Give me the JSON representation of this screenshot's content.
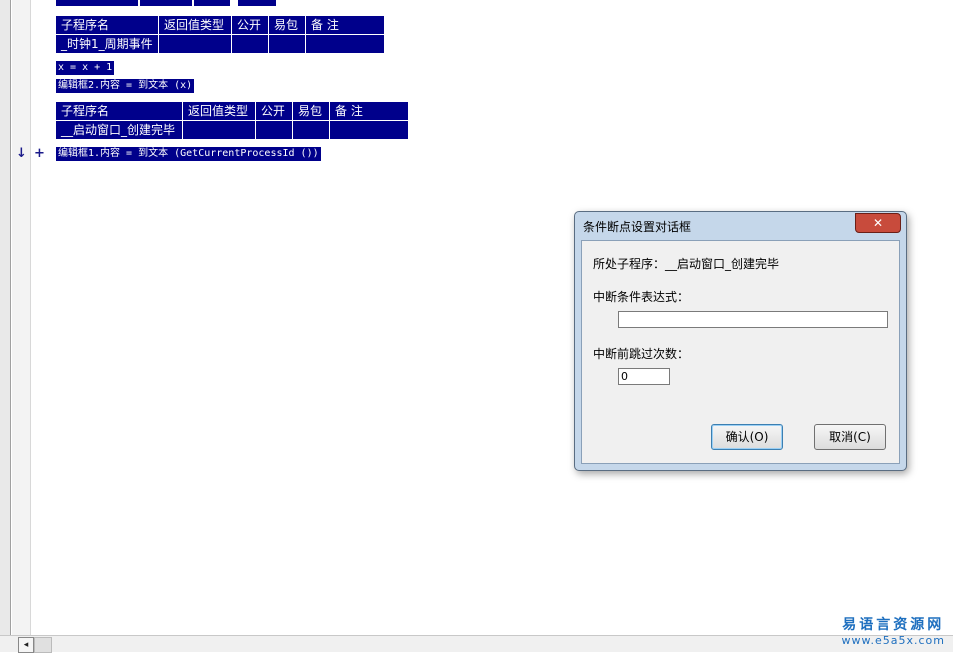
{
  "editor": {
    "table1": {
      "headers": [
        "子程序名",
        "返回值类型",
        "公开",
        "易包",
        "备 注"
      ],
      "name": "_时钟1_周期事件"
    },
    "line1": "x = x + 1",
    "line2": "编辑框2.内容 = 到文本 (x)",
    "table2": {
      "headers": [
        "子程序名",
        "返回值类型",
        "公开",
        "易包",
        "备 注"
      ],
      "name": "__启动窗口_创建完毕"
    },
    "line3": "编辑框1.内容 = 到文本 (GetCurrentProcessId ())",
    "marker_arrow": "↓",
    "marker_plus": "+"
  },
  "dialog": {
    "title": "条件断点设置对话框",
    "close": "✕",
    "subprogram_label": "所处子程序：__启动窗口_创建完毕",
    "condition_label": "中断条件表达式：",
    "condition_value": "",
    "skip_label": "中断前跳过次数：",
    "skip_value": "0",
    "ok_label": "确认(O)",
    "cancel_label": "取消(C)"
  },
  "scrollbar": {
    "left_arrow": "◂"
  },
  "watermark": {
    "cn": "易语言资源网",
    "url": "www.e5a5x.com"
  }
}
